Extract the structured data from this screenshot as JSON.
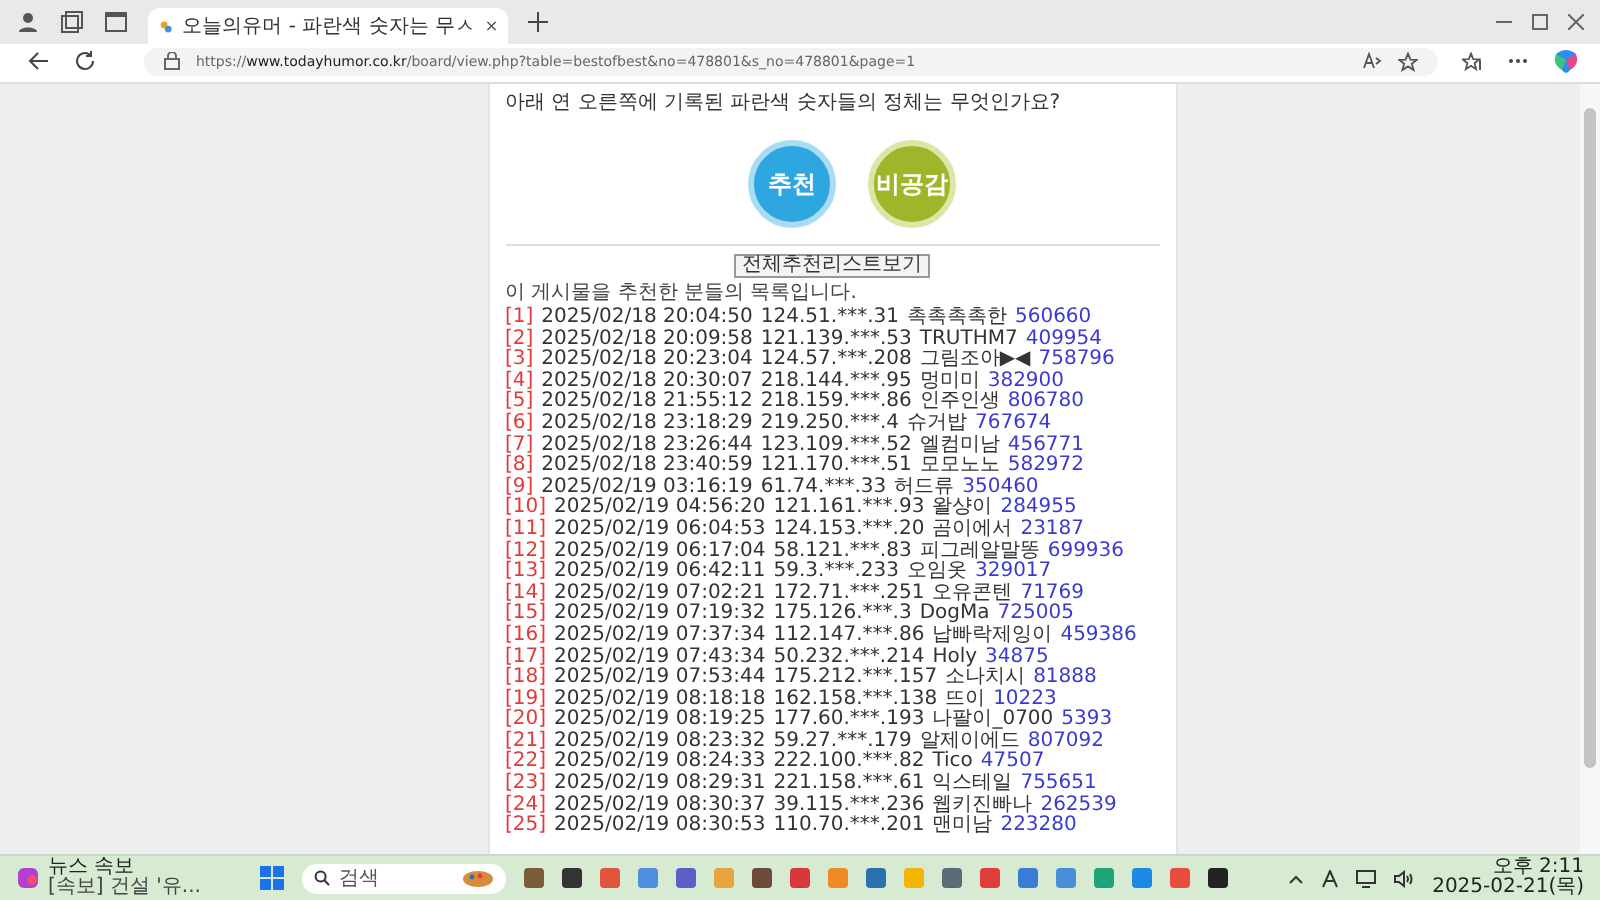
{
  "browser": {
    "tab_title": "오늘의유머 - 파란색 숫자는 무ㅅ",
    "url_prefix": "https://",
    "url_host": "www.todayhumor.co.kr",
    "url_path": "/board/view.php?table=bestofbest&no=478801&s_no=478801&page=1"
  },
  "post": {
    "question": "아래 연 오른쪽에 기록된 파란색 숫자들의 정체는 무엇인가요?",
    "vote_buttons": [
      "추천",
      "비공감"
    ],
    "list_button": "전체추천리스트보기",
    "list_caption": "이 게시물을 추천한 분들의 목록입니다."
  },
  "recommenders": [
    {
      "index": "[1]",
      "time": "2025/02/18 20:04:50",
      "ip": "124.51.***.31",
      "nick": "촉촉촉촉한",
      "number": "560660"
    },
    {
      "index": "[2]",
      "time": "2025/02/18 20:09:58",
      "ip": "121.139.***.53",
      "nick": "TRUTHM7",
      "number": "409954"
    },
    {
      "index": "[3]",
      "time": "2025/02/18 20:23:04",
      "ip": "124.57.***.208",
      "nick": "그림조아▶◀",
      "number": "758796"
    },
    {
      "index": "[4]",
      "time": "2025/02/18 20:30:07",
      "ip": "218.144.***.95",
      "nick": "멍미미",
      "number": "382900"
    },
    {
      "index": "[5]",
      "time": "2025/02/18 21:55:12",
      "ip": "218.159.***.86",
      "nick": "인주인생",
      "number": "806780"
    },
    {
      "index": "[6]",
      "time": "2025/02/18 23:18:29",
      "ip": "219.250.***.4",
      "nick": "슈거밥",
      "number": "767674"
    },
    {
      "index": "[7]",
      "time": "2025/02/18 23:26:44",
      "ip": "123.109.***.52",
      "nick": "엘컴미남",
      "number": "456771"
    },
    {
      "index": "[8]",
      "time": "2025/02/18 23:40:59",
      "ip": "121.170.***.51",
      "nick": "모모노노",
      "number": "582972"
    },
    {
      "index": "[9]",
      "time": "2025/02/19 03:16:19",
      "ip": "61.74.***.33",
      "nick": "허드류",
      "number": "350460"
    },
    {
      "index": "[10]",
      "time": "2025/02/19 04:56:20",
      "ip": "121.161.***.93",
      "nick": "왈샹이",
      "number": "284955"
    },
    {
      "index": "[11]",
      "time": "2025/02/19 06:04:53",
      "ip": "124.153.***.20",
      "nick": "곰이에서",
      "number": "23187"
    },
    {
      "index": "[12]",
      "time": "2025/02/19 06:17:04",
      "ip": "58.121.***.83",
      "nick": "피그레알말똥",
      "number": "699936"
    },
    {
      "index": "[13]",
      "time": "2025/02/19 06:42:11",
      "ip": "59.3.***.233",
      "nick": "오임옷",
      "number": "329017"
    },
    {
      "index": "[14]",
      "time": "2025/02/19 07:02:21",
      "ip": "172.71.***.251",
      "nick": "오유콘텐",
      "number": "71769"
    },
    {
      "index": "[15]",
      "time": "2025/02/19 07:19:32",
      "ip": "175.126.***.3",
      "nick": "DogMa",
      "number": "725005"
    },
    {
      "index": "[16]",
      "time": "2025/02/19 07:37:34",
      "ip": "112.147.***.86",
      "nick": "납빠락제잉이",
      "number": "459386"
    },
    {
      "index": "[17]",
      "time": "2025/02/19 07:43:34",
      "ip": "50.232.***.214",
      "nick": "Holy",
      "number": "34875"
    },
    {
      "index": "[18]",
      "time": "2025/02/19 07:53:44",
      "ip": "175.212.***.157",
      "nick": "소나치시",
      "number": "81888"
    },
    {
      "index": "[19]",
      "time": "2025/02/19 08:18:18",
      "ip": "162.158.***.138",
      "nick": "뜨이",
      "number": "10223"
    },
    {
      "index": "[20]",
      "time": "2025/02/19 08:19:25",
      "ip": "177.60.***.193",
      "nick": "나팔이_0700",
      "number": "5393"
    },
    {
      "index": "[21]",
      "time": "2025/02/19 08:23:32",
      "ip": "59.27.***.179",
      "nick": "알제이에드",
      "number": "807092"
    },
    {
      "index": "[22]",
      "time": "2025/02/19 08:24:33",
      "ip": "222.100.***.82",
      "nick": "Tico",
      "number": "47507"
    },
    {
      "index": "[23]",
      "time": "2025/02/19 08:29:31",
      "ip": "221.158.***.61",
      "nick": "익스테일",
      "number": "755651"
    },
    {
      "index": "[24]",
      "time": "2025/02/19 08:30:37",
      "ip": "39.115.***.236",
      "nick": "웹키진빠나",
      "number": "262539"
    },
    {
      "index": "[25]",
      "time": "2025/02/19 08:30:53",
      "ip": "110.70.***.201",
      "nick": "맨미남",
      "number": "223280"
    }
  ],
  "taskbar": {
    "news_title": "뉴스 속보",
    "news_text": "[속보] 건설 '유...",
    "search_placeholder": "검색",
    "time": "오후 2:11",
    "date": "2025-02-21(목)"
  }
}
